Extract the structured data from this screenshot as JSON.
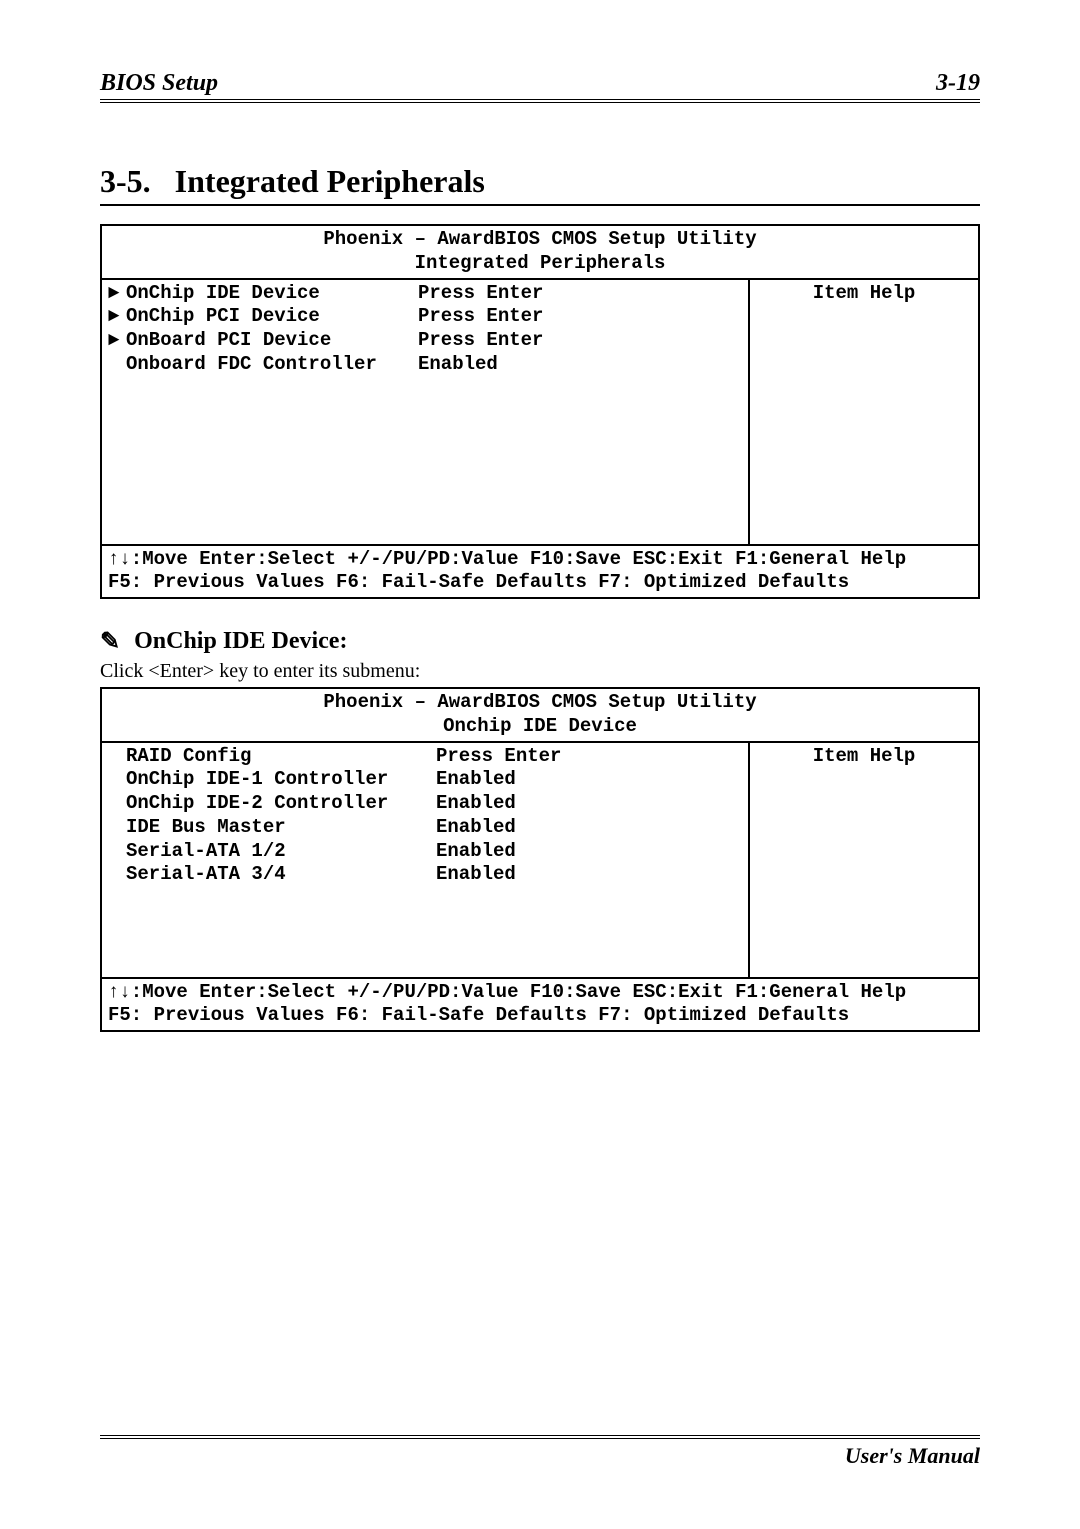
{
  "header": {
    "left": "BIOS Setup",
    "right": "3-19"
  },
  "footer": {
    "right": "User's Manual"
  },
  "section": {
    "number": "3-5.",
    "title": "Integrated Peripherals"
  },
  "bios1": {
    "title": "Phoenix – AwardBIOS CMOS Setup Utility",
    "subtitle": "Integrated Peripherals",
    "help_header": "Item Help",
    "rows": [
      {
        "marker": "►",
        "label": "OnChip IDE Device",
        "value": "Press Enter"
      },
      {
        "marker": "►",
        "label": "OnChip PCI Device",
        "value": "Press Enter"
      },
      {
        "marker": "►",
        "label": "OnBoard PCI Device",
        "value": "Press Enter"
      },
      {
        "marker": "",
        "label": "Onboard FDC Controller",
        "value": "Enabled"
      }
    ],
    "foot1": "↑↓:Move Enter:Select +/-/PU/PD:Value F10:Save ESC:Exit F1:General Help",
    "foot2": "F5: Previous Values   F6: Fail-Safe Defaults   F7: Optimized Defaults"
  },
  "subheading": {
    "icon": "✎",
    "title": "OnChip IDE Device:",
    "desc": "Click <Enter> key to enter its submenu:"
  },
  "bios2": {
    "title": "Phoenix – AwardBIOS CMOS Setup Utility",
    "subtitle": "Onchip IDE Device",
    "help_header": "Item Help",
    "rows": [
      {
        "label": "RAID Config",
        "value": "Press Enter"
      },
      {
        "label": "OnChip IDE-1 Controller",
        "value": "Enabled"
      },
      {
        "label": "OnChip IDE-2 Controller",
        "value": "Enabled"
      },
      {
        "label": "IDE Bus Master",
        "value": "Enabled"
      },
      {
        "label": "Serial-ATA 1/2",
        "value": "Enabled"
      },
      {
        "label": "Serial-ATA 3/4",
        "value": "Enabled"
      }
    ],
    "foot1": "↑↓:Move Enter:Select +/-/PU/PD:Value F10:Save ESC:Exit F1:General Help",
    "foot2": "F5: Previous Values   F6: Fail-Safe Defaults   F7: Optimized Defaults"
  }
}
